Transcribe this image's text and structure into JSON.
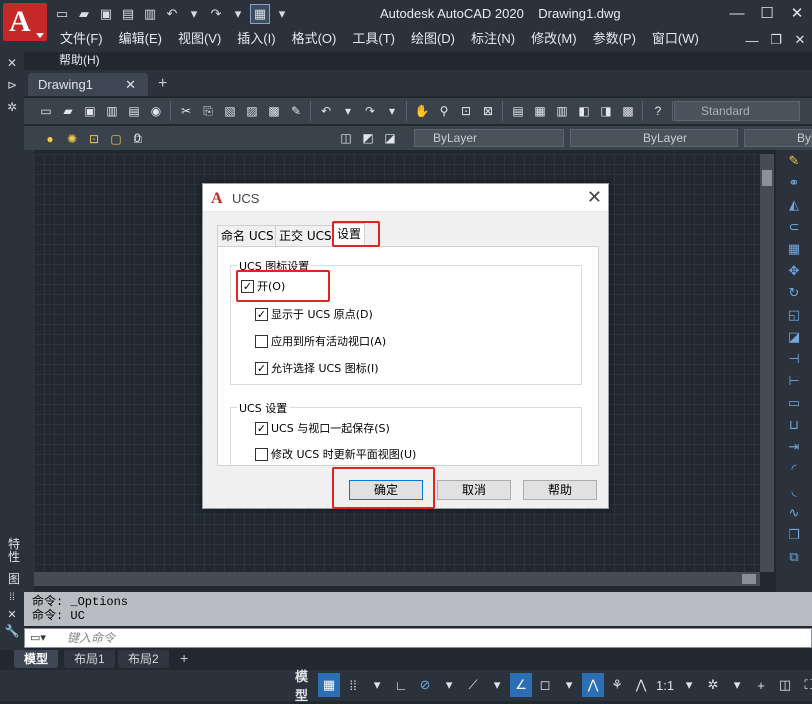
{
  "app": {
    "title": "Autodesk AutoCAD 2020",
    "document": "Drawing1.dwg",
    "logo": "A"
  },
  "menus": [
    "文件(F)",
    "编辑(E)",
    "视图(V)",
    "插入(I)",
    "格式(O)",
    "工具(T)",
    "绘图(D)",
    "标注(N)",
    "修改(M)",
    "参数(P)",
    "窗口(W)"
  ],
  "menu_help": "帮助(H)",
  "doc_tab": "Drawing1",
  "toolbar": {
    "text_style": "Standard",
    "layer": "0",
    "color": "ByLayer",
    "linetype": "ByLayer",
    "lineweight": "ByLa"
  },
  "dialog": {
    "title": "UCS",
    "tabs": [
      "命名 UCS",
      "正交 UCS",
      "设置"
    ],
    "group1_label": "UCS 图标设置",
    "group1": [
      {
        "label": "开(O)",
        "checked": true
      },
      {
        "label": "显示于 UCS 原点(D)",
        "checked": true
      },
      {
        "label": "应用到所有活动视口(A)",
        "checked": false
      },
      {
        "label": "允许选择 UCS 图标(I)",
        "checked": true
      }
    ],
    "group2_label": "UCS 设置",
    "group2": [
      {
        "label": "UCS 与视口一起保存(S)",
        "checked": true
      },
      {
        "label": "修改 UCS 时更新平面视图(U)",
        "checked": false
      }
    ],
    "ok": "确定",
    "cancel": "取消",
    "help": "帮助"
  },
  "command": {
    "history": [
      "命令: _Options",
      "命令: UC"
    ],
    "placeholder": "键入命令"
  },
  "left_labels": {
    "props": "特性",
    "other": "图"
  },
  "layout_tabs": [
    "模型",
    "布局1",
    "布局2"
  ],
  "status": {
    "model": "模型",
    "scale": "1:1"
  },
  "colors": {
    "accent": "#2d6fb5",
    "highlight": "#e02424",
    "logo": "#c62828"
  }
}
